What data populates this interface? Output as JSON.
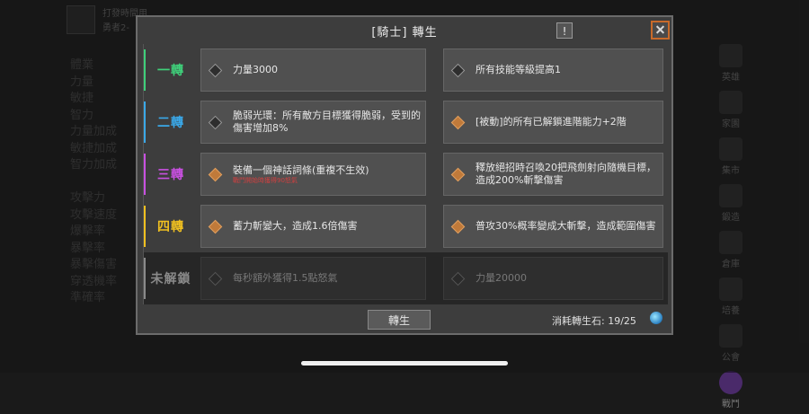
{
  "background": {
    "name_line1": "打發時間用",
    "name_line2": "勇者2-",
    "stats": [
      "體業",
      "力量",
      "敏捷",
      "智力",
      "力量加成",
      "敏捷加成",
      "智力加成",
      "",
      "攻擊力",
      "攻擊速度",
      "爆擊率",
      "暴擊率",
      "暴擊傷害",
      "穿透機率",
      "準確率"
    ],
    "side_buttons": [
      "英雄",
      "家園",
      "集市",
      "鍛造",
      "倉庫",
      "培養",
      "公會",
      "戰鬥"
    ]
  },
  "dialog": {
    "title": "[騎士] 轉生",
    "info_label": "!",
    "rows": [
      {
        "tier": "一轉",
        "color": "#3fd07a",
        "left": {
          "text": "力量3000",
          "sub": "",
          "active": false
        },
        "right": {
          "text": "所有技能等級提高1",
          "sub": "",
          "active": false
        }
      },
      {
        "tier": "二轉",
        "color": "#3aa8e8",
        "left": {
          "text": "脆弱光環：所有敵方目標獲得脆弱，受到的傷害增加8%",
          "sub": "",
          "active": false
        },
        "right": {
          "text": "[被動]的所有已解鎖進階能力+2階",
          "sub": "",
          "active": true
        }
      },
      {
        "tier": "三轉",
        "color": "#c850e0",
        "left": {
          "text": "裝備一個神話詞條(重複不生效)",
          "sub": "戰鬥開始時獲得90怒氣",
          "active": true
        },
        "right": {
          "text": "釋放絕招時召喚20把飛劍射向隨機目標，造成200%斬擊傷害",
          "sub": "",
          "active": true
        }
      },
      {
        "tier": "四轉",
        "color": "#f0c020",
        "left": {
          "text": "蓄力斬變大，造成1.6倍傷害",
          "sub": "",
          "active": true
        },
        "right": {
          "text": "普攻30%概率變成大斬擊，造成範圍傷害",
          "sub": "",
          "active": true
        }
      },
      {
        "tier": "未解鎖",
        "color": "#8a8a8a",
        "left": {
          "text": "每秒額外獲得1.5點怒氣",
          "sub": "",
          "active": false
        },
        "right": {
          "text": "力量20000",
          "sub": "",
          "active": false
        }
      }
    ],
    "rebirth_button": "轉生",
    "cost_text": "消耗轉生石: 19/25"
  }
}
